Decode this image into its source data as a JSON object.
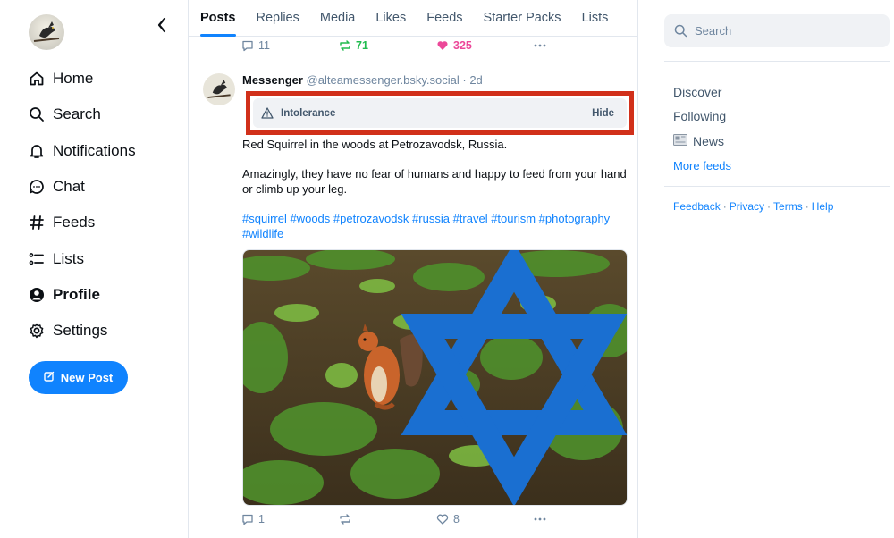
{
  "nav": {
    "items": [
      {
        "label": "Home",
        "icon": "home-icon"
      },
      {
        "label": "Search",
        "icon": "search-icon"
      },
      {
        "label": "Notifications",
        "icon": "bell-icon"
      },
      {
        "label": "Chat",
        "icon": "chat-icon"
      },
      {
        "label": "Feeds",
        "icon": "hash-icon"
      },
      {
        "label": "Lists",
        "icon": "list-icon"
      },
      {
        "label": "Profile",
        "icon": "user-circle-icon"
      },
      {
        "label": "Settings",
        "icon": "gear-icon"
      }
    ],
    "active": "Profile",
    "new_post_label": "New Post"
  },
  "tabs": [
    "Posts",
    "Replies",
    "Media",
    "Likes",
    "Feeds",
    "Starter Packs",
    "Lists"
  ],
  "active_tab": "Posts",
  "previous_post": {
    "replies": "11",
    "reposts": "71",
    "likes": "325"
  },
  "post": {
    "author_name": "Messenger",
    "author_handle": "@alteamessenger.bsky.social",
    "time": "· 2d",
    "label": "Intolerance",
    "hide_label": "Hide",
    "text_1": "Red Squirrel in the woods at Petrozavodsk, Russia.",
    "text_2": "Amazingly, they have no fear of humans and happy to feed from your hand or climb up your leg.",
    "tags": "#squirrel #woods #petrozavodsk #russia #travel #tourism #photography #wildlife",
    "replies": "1",
    "reposts": "",
    "likes": "8"
  },
  "sidebar": {
    "search_placeholder": "Search",
    "feeds": [
      "Discover",
      "Following",
      "News"
    ],
    "more_feeds": "More feeds",
    "footer": [
      "Feedback",
      "Privacy",
      "Terms",
      "Help"
    ]
  },
  "colors": {
    "accent": "#1083fe",
    "warning_outline": "#d1301a",
    "repost_green": "#20bc4f",
    "like_pink": "#ec4899",
    "star_blue": "#1a6fd1"
  }
}
